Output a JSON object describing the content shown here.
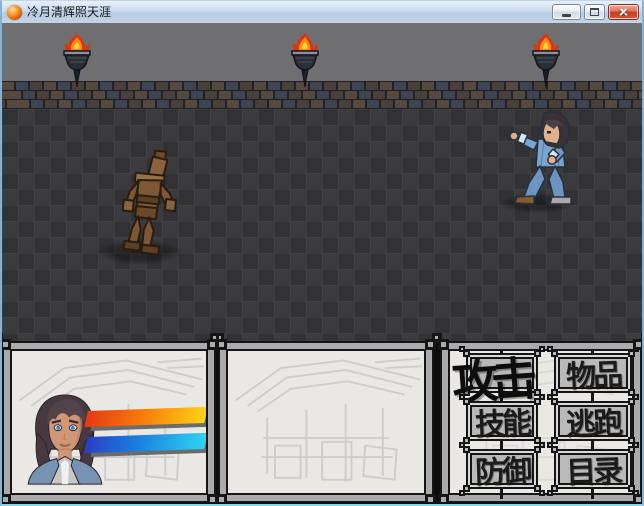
{
  "window": {
    "title": "冷月清辉照天涯",
    "controls": {
      "minimize": "minimize",
      "maximize": "maximize",
      "close": "close"
    }
  },
  "scene": {
    "torch_count": 3,
    "enemy_sprite": "wooden-training-dummy",
    "player_sprite": "martial-artist-blue"
  },
  "status": {
    "hp_percent": 100,
    "mp_percent": 100,
    "hp_color_start": "#e63a14",
    "hp_color_end": "#ffd317",
    "mp_color_start": "#2a3ec4",
    "mp_color_end": "#2fd4f2"
  },
  "commands": [
    {
      "id": "attack",
      "label": "攻击",
      "selected": true
    },
    {
      "id": "item",
      "label": "物品",
      "selected": false
    },
    {
      "id": "skill",
      "label": "技能",
      "selected": false
    },
    {
      "id": "escape",
      "label": "逃跑",
      "selected": false
    },
    {
      "id": "defend",
      "label": "防御",
      "selected": false
    },
    {
      "id": "menu",
      "label": "目录",
      "selected": false
    }
  ]
}
